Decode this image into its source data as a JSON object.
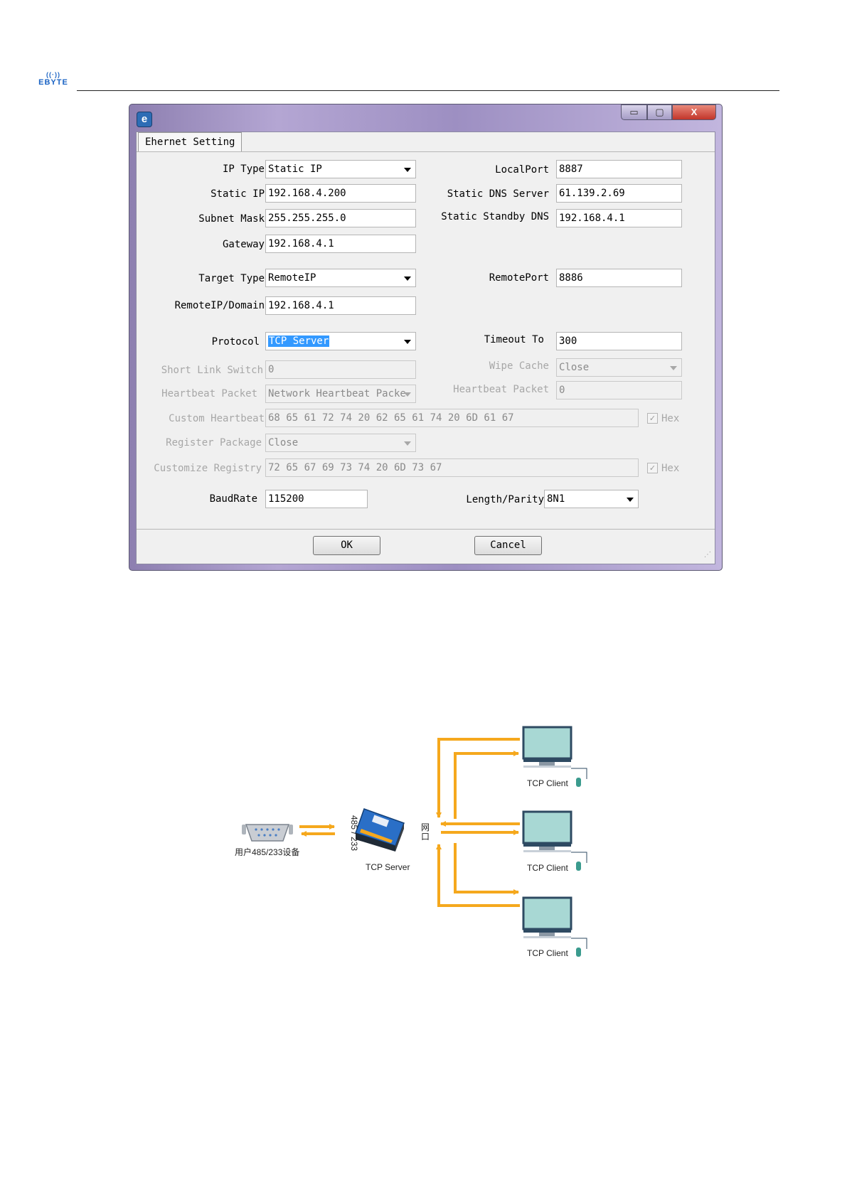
{
  "header": {
    "logo_text": "EBYTE"
  },
  "window": {
    "tab_label": "Ehernet Setting",
    "titlebar_buttons": {
      "minimize": "▭",
      "maximize": "▢",
      "close": "X"
    },
    "fields": {
      "ip_type": {
        "label": "IP Type",
        "value": "Static IP"
      },
      "static_ip": {
        "label": "Static IP",
        "value": "192.168.4.200"
      },
      "subnet_mask": {
        "label": "Subnet Mask",
        "value": "255.255.255.0"
      },
      "gateway": {
        "label": "Gateway",
        "value": "192.168.4.1"
      },
      "local_port": {
        "label": "LocalPort",
        "value": "8887"
      },
      "static_dns": {
        "label": "Static DNS Server",
        "value": "61.139.2.69"
      },
      "standby_dns": {
        "label": "Static Standby DNS",
        "value": "192.168.4.1"
      },
      "target_type": {
        "label": "Target Type",
        "value": "RemoteIP"
      },
      "remote_port": {
        "label": "RemotePort",
        "value": "8886"
      },
      "remote_ip": {
        "label": "RemoteIP/Domain",
        "value": "192.168.4.1"
      },
      "protocol": {
        "label": "Protocol",
        "value": "TCP Server"
      },
      "timeout": {
        "label": "Timeout To",
        "value": "300"
      },
      "short_link": {
        "label": "Short Link Switch",
        "value": "0"
      },
      "wipe_cache": {
        "label": "Wipe Cache",
        "value": "Close"
      },
      "heartbeat_packet": {
        "label": "Heartbeat Packet",
        "value": "Network Heartbeat Packe"
      },
      "heartbeat_packet_value": {
        "label": "Heartbeat Packet",
        "value": "0"
      },
      "custom_heartbeat": {
        "label": "Custom Heartbeat",
        "value": "68 65 61 72 74 20 62 65 61 74 20 6D 61 67",
        "hex_label": "Hex"
      },
      "register_package": {
        "label": "Register Package",
        "value": "Close"
      },
      "customize_registry": {
        "label": "Customize Registry",
        "value": "72 65 67 69 73 74 20 6D 73 67",
        "hex_label": "Hex"
      },
      "baud_rate": {
        "label": "BaudRate",
        "value": "115200"
      },
      "length_parity": {
        "label": "Length/Parity",
        "value": "8N1"
      }
    },
    "buttons": {
      "ok": "OK",
      "cancel": "Cancel"
    }
  },
  "diagram": {
    "user_device_label": "用户485/233设备",
    "interface_label": "485 / 233",
    "port_label": "网口",
    "server_label": "TCP Server",
    "client_labels": [
      "TCP Client",
      "TCP Client",
      "TCP Client"
    ],
    "colors": {
      "arrow": "#f5a81d",
      "screen": "#a8d8d4",
      "monitor_frame": "#2e4a62",
      "device": "#2a6fc7"
    }
  }
}
